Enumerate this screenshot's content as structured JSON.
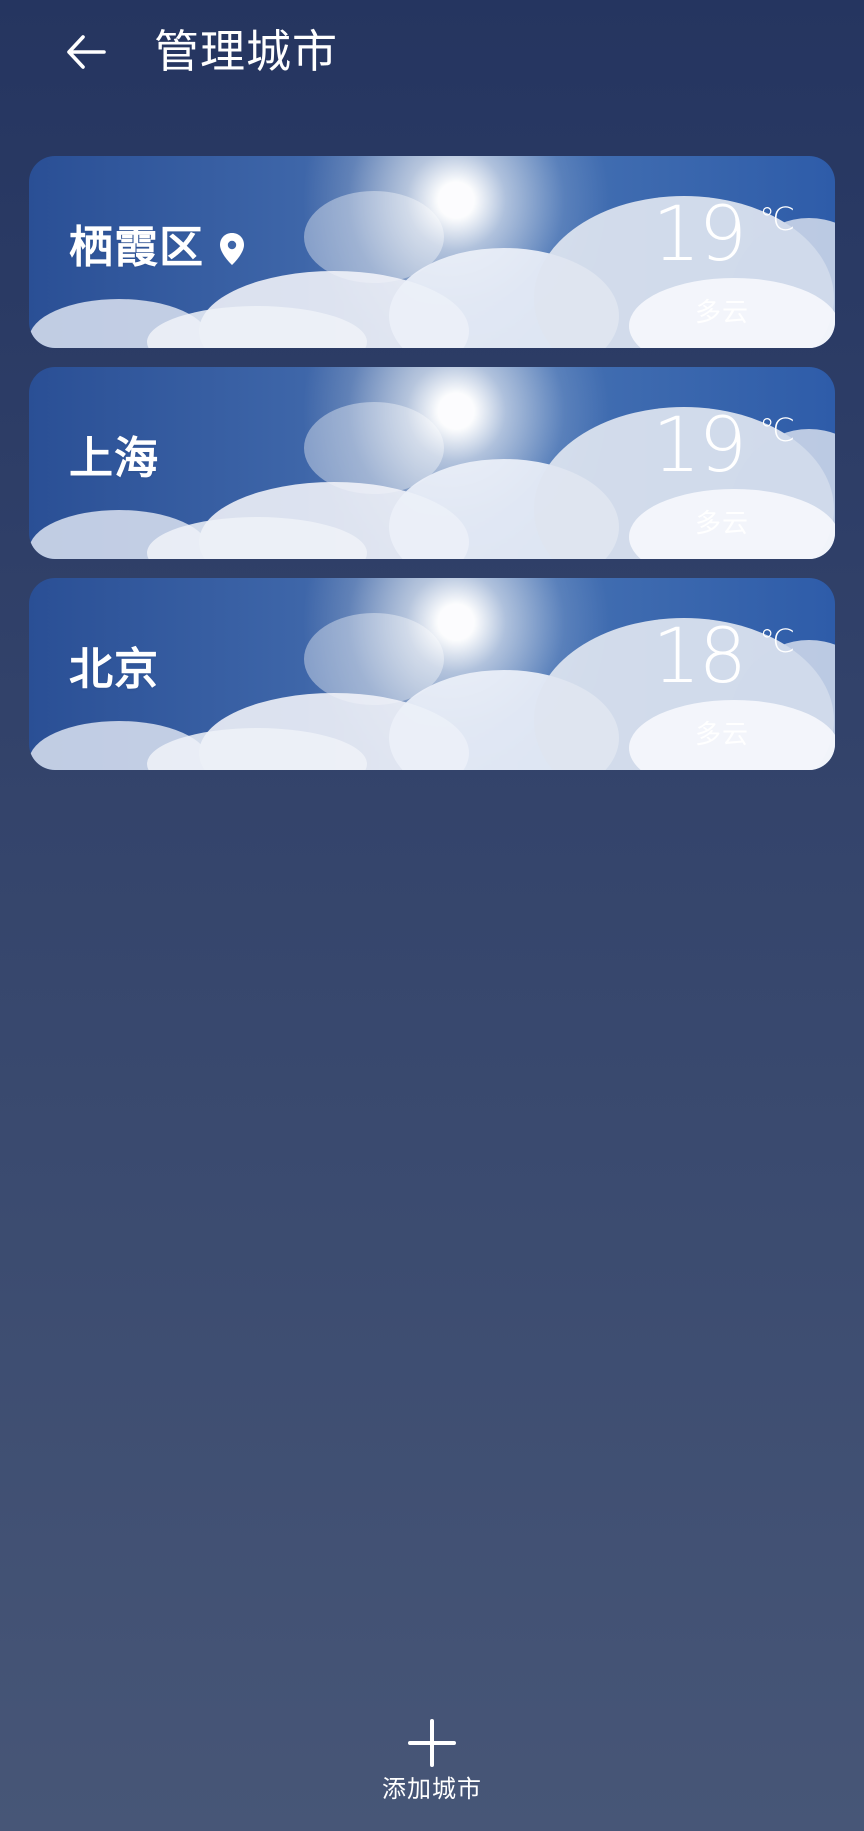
{
  "header": {
    "title": "管理城市",
    "back_icon": "arrow-left-icon"
  },
  "cities": [
    {
      "name": "栖霞区",
      "temperature": "19",
      "unit": "℃",
      "condition": "多云",
      "location_icon": "location-pin-icon"
    },
    {
      "name": "上海",
      "temperature": "19",
      "unit": "℃",
      "condition": "多云"
    },
    {
      "name": "北京",
      "temperature": "18",
      "unit": "℃",
      "condition": "多云"
    }
  ],
  "footer": {
    "add_label": "添加城市",
    "add_icon": "plus-icon"
  },
  "colors": {
    "background_top": "#253560",
    "background_bottom": "#475677",
    "card_sky": "#2e5ca9",
    "text": "#ffffff"
  }
}
